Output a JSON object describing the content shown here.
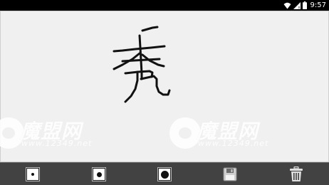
{
  "status_bar": {
    "time": "9:57",
    "icons": [
      "wifi-icon",
      "signal-icon",
      "battery-icon"
    ]
  },
  "canvas": {
    "background": "#f0f0f0",
    "stroke_color": "#111111",
    "drawn_character": "秀"
  },
  "watermark": {
    "brand": "魔盟网",
    "url": "www.12349.net"
  },
  "toolbar": {
    "background": "#424242",
    "tools": [
      {
        "name": "brush-small",
        "icon": "small-dot-icon"
      },
      {
        "name": "brush-medium",
        "icon": "medium-dot-icon"
      },
      {
        "name": "brush-large",
        "icon": "large-dot-icon"
      },
      {
        "name": "save",
        "icon": "floppy-disk-icon"
      },
      {
        "name": "clear",
        "icon": "trash-icon"
      }
    ]
  }
}
